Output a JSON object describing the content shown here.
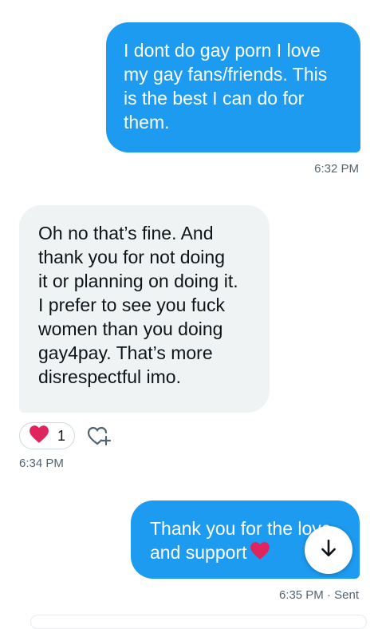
{
  "conversation": {
    "messages": [
      {
        "direction": "sent",
        "lines": [
          "I dont do gay porn I love",
          "my gay fans/friends. This",
          "is the best I can do for",
          "them."
        ],
        "timestamp": "6:32 PM"
      },
      {
        "direction": "received",
        "lines": [
          "Oh no that’s fine. And",
          "thank you for not doing",
          "it or planning on doing it.",
          "I prefer to see you fuck",
          "women than you doing",
          "gay4pay. That’s more",
          "disrespectful imo."
        ],
        "reaction": {
          "emoji": "heart",
          "count": "1"
        },
        "timestamp": "6:34 PM"
      },
      {
        "direction": "sent",
        "lines": [
          "Thank you for the love",
          "and support"
        ],
        "emoji": "red-heart",
        "timestamp": "6:35 PM · Sent"
      }
    ]
  },
  "colors": {
    "sent_bubble": "#1d9bf0",
    "received_bubble": "#eff3f4",
    "timestamp": "#536471",
    "heart": "#e0245e"
  },
  "icons": {
    "reaction": "heart-icon",
    "add_reaction": "add-reaction-icon",
    "scroll_down": "arrow-down-icon"
  }
}
